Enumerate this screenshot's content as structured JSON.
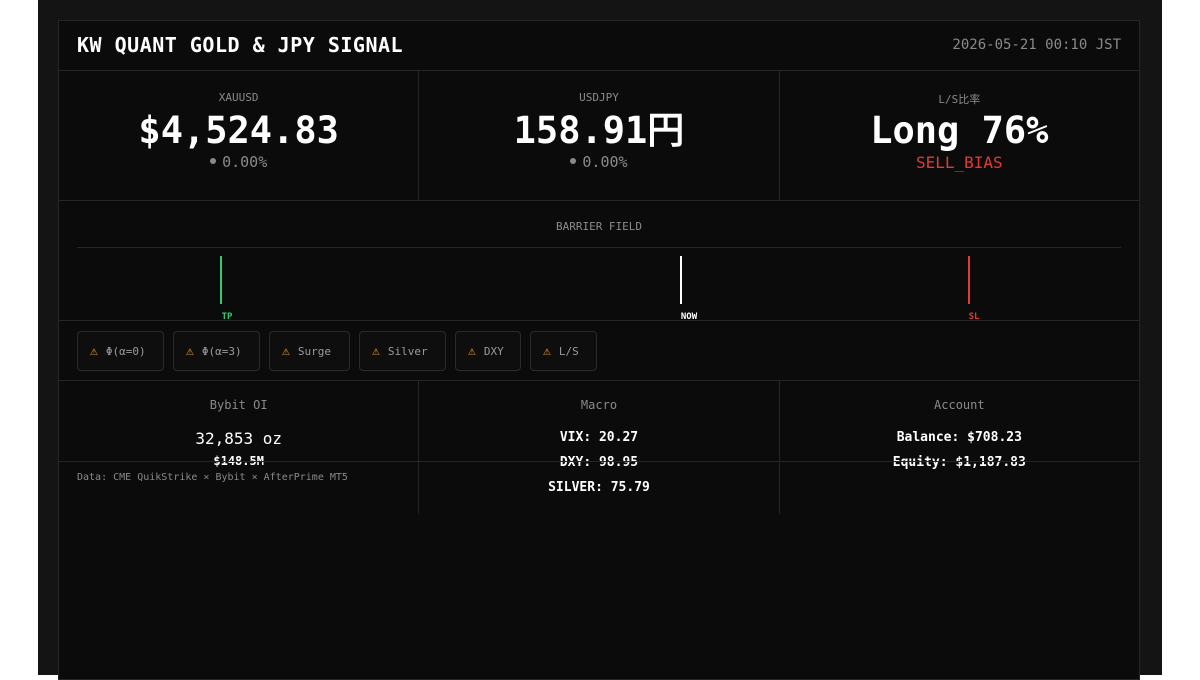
{
  "header": {
    "title": "KW QUANT GOLD & JPY SIGNAL",
    "timestamp": "2026-05-21 00:10 JST"
  },
  "cards": {
    "xauusd": {
      "label": "XAUUSD",
      "value": "$4,524.83",
      "change": "0.00%"
    },
    "usdjpy": {
      "label": "USDJPY",
      "value": "158.91円",
      "change": "0.00%"
    },
    "ls": {
      "label": "L/S比率",
      "value": "Long 76%",
      "bias": "SELL_BIAS",
      "bias_color": "#e53935"
    }
  },
  "barrier": {
    "title": "BARRIER FIELD",
    "markers": [
      {
        "label": "TP",
        "color": "#2ecc71"
      },
      {
        "label": "NOW",
        "color": "#ffffff"
      },
      {
        "label": "SL",
        "color": "#e53935"
      }
    ]
  },
  "warnings": {
    "icon": "warning-icon",
    "icon_color": "#f0a030",
    "items": [
      "Φ(α=0)",
      "Φ(α=3)",
      "Surge",
      "Silver",
      "DXY",
      "L/S"
    ]
  },
  "bybit": {
    "label": "Bybit OI",
    "oi": "32,853 oz",
    "notional": "$148.5M"
  },
  "macro": {
    "label": "Macro",
    "vix": "VIX: 20.27",
    "dxy": "DXY: 98.95",
    "silver": "SILVER: 75.79"
  },
  "account": {
    "label": "Account",
    "balance": "Balance: $708.23",
    "equity": "Equity: $1,187.83"
  },
  "footer": {
    "source": "Data: CME QuikStrike × Bybit × AfterPrime MT5"
  }
}
